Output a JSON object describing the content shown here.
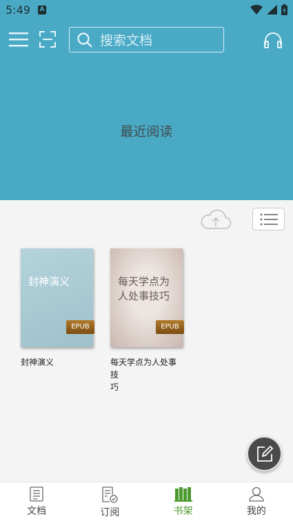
{
  "status_bar": {
    "time": "5:49",
    "notification_badge": "A"
  },
  "appbar": {
    "menu_icon": "menu-icon",
    "scan_icon": "scan-icon",
    "search_placeholder": "搜索文档",
    "headphones_icon": "headphones-icon"
  },
  "recent_reading": {
    "label": "最近阅读"
  },
  "toolbar": {
    "upload_icon": "cloud-upload-icon",
    "list_icon": "list-view-icon"
  },
  "books": [
    {
      "cover_title": "封神演义",
      "format": "EPUB",
      "title": "封神演义",
      "cover_color": "#a9c9d3"
    },
    {
      "cover_title_line1": "每天学点为",
      "cover_title_line2": "人处事技巧",
      "format": "EPUB",
      "title_line1": "每天学点为人处事技",
      "title_line2": "巧",
      "cover_color": "#e2d8d3"
    }
  ],
  "fab": {
    "icon": "edit-icon"
  },
  "bottom_nav": [
    {
      "label": "文档",
      "icon": "document-icon",
      "active": false
    },
    {
      "label": "订阅",
      "icon": "subscribe-icon",
      "active": false
    },
    {
      "label": "书架",
      "icon": "bookshelf-icon",
      "active": true
    },
    {
      "label": "我的",
      "icon": "profile-icon",
      "active": false
    }
  ],
  "colors": {
    "header": "#4aaac6",
    "active_tab": "#4a9a2e",
    "background": "#f4f4f4"
  }
}
